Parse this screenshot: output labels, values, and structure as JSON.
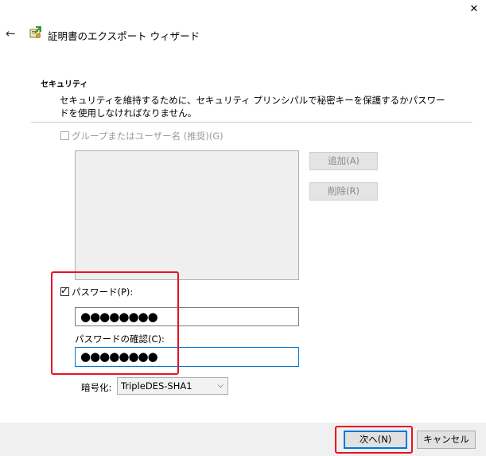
{
  "window": {
    "close_glyph": "✕",
    "back_glyph": "←",
    "title": "証明書のエクスポート ウィザード"
  },
  "section": {
    "title": "セキュリティ",
    "description": "セキュリティを維持するために、セキュリティ プリンシパルで秘密キーを保護するかパスワードを使用しなければなりません。"
  },
  "group": {
    "checkbox_label": "グループまたはユーザー名 (推奨)(G)",
    "checked": false,
    "enabled": false,
    "add_label": "追加(A)",
    "remove_label": "削除(R)"
  },
  "password": {
    "checkbox_label": "パスワード(P):",
    "checked": true,
    "value": "●●●●●●●●",
    "confirm_label": "パスワードの確認(C):",
    "confirm_value": "●●●●●●●●"
  },
  "encryption": {
    "label": "暗号化:",
    "selected": "TripleDES-SHA1",
    "chevron_glyph": "⌵"
  },
  "footer": {
    "next_label": "次へ(N)",
    "cancel_label": "キャンセル"
  },
  "colors": {
    "highlight": "#e81123",
    "focus_blue": "#0078d7"
  }
}
